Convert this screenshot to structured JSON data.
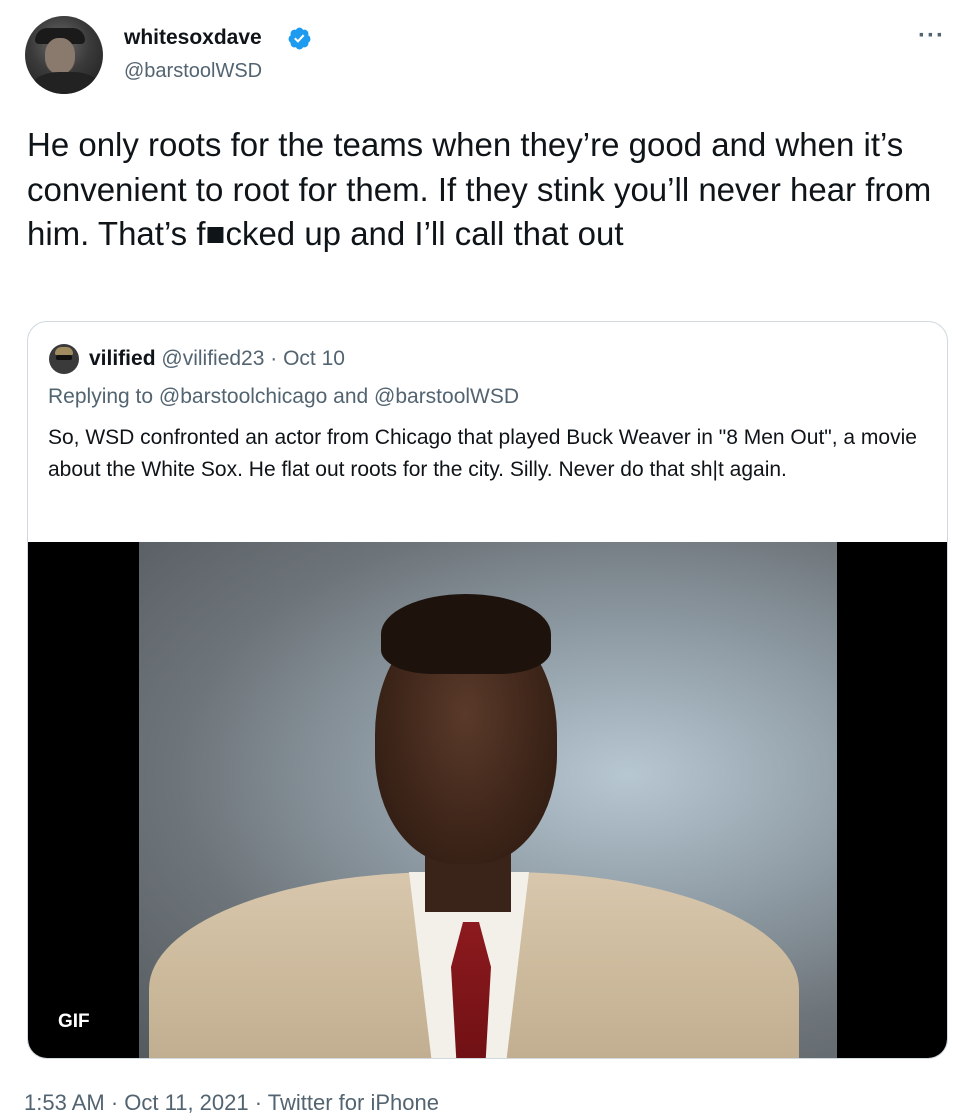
{
  "author": {
    "display_name": "whitesoxdave",
    "handle": "@barstoolWSD",
    "verified": true,
    "avatar_icon": "user-avatar"
  },
  "more_label": "···",
  "tweet": {
    "text": "He only roots for the teams when they’re good and when it’s convenient to root for them. If they stink you’ll never hear from him. That’s f■cked up and I’ll call that out"
  },
  "quote": {
    "name": "vilified",
    "handle": "@vilified23",
    "separator": "·",
    "date": "Oct 10",
    "replying": "Replying to @barstoolchicago and @barstoolWSD",
    "text": "So, WSD confronted an actor from Chicago that played Buck Weaver in \"8 Men Out\", a movie about the White Sox. He flat out roots for the city. Silly. Never do that sh|t again.",
    "media_badge": "GIF"
  },
  "footer": {
    "timestamp": "1:53 AM · Oct 11, 2021 · Twitter for iPhone"
  },
  "colors": {
    "text_primary": "#0f1419",
    "text_secondary": "#536471",
    "verified_blue": "#1d9bf0",
    "border": "#cfd9de"
  }
}
